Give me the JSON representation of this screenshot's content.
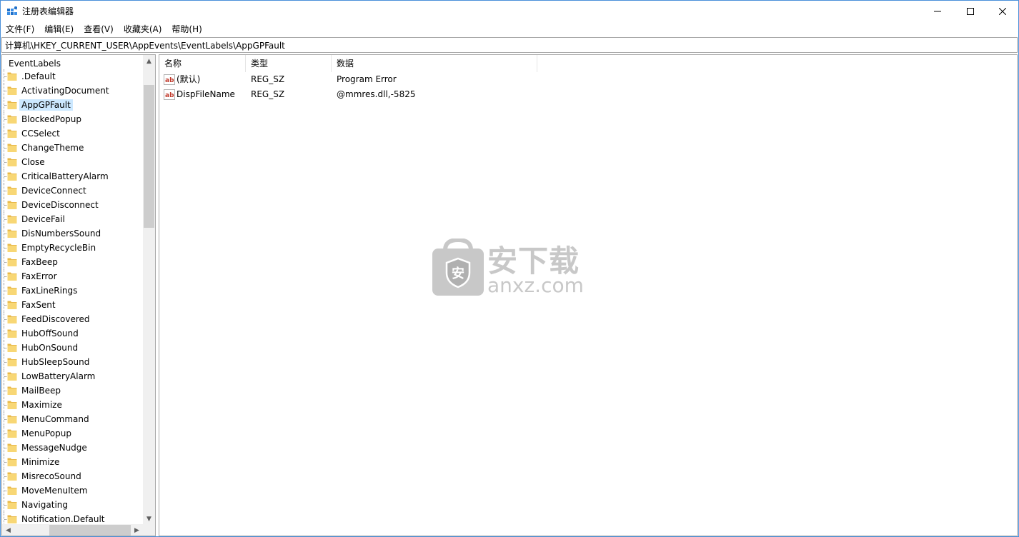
{
  "window": {
    "title": "注册表编辑器"
  },
  "menu": {
    "items": [
      "文件(F)",
      "编辑(E)",
      "查看(V)",
      "收藏夹(A)",
      "帮助(H)"
    ]
  },
  "address": {
    "path": "计算机\\HKEY_CURRENT_USER\\AppEvents\\EventLabels\\AppGPFault"
  },
  "tree": {
    "root": "EventLabels",
    "items": [
      ".Default",
      "ActivatingDocument",
      "AppGPFault",
      "BlockedPopup",
      "CCSelect",
      "ChangeTheme",
      "Close",
      "CriticalBatteryAlarm",
      "DeviceConnect",
      "DeviceDisconnect",
      "DeviceFail",
      "DisNumbersSound",
      "EmptyRecycleBin",
      "FaxBeep",
      "FaxError",
      "FaxLineRings",
      "FaxSent",
      "FeedDiscovered",
      "HubOffSound",
      "HubOnSound",
      "HubSleepSound",
      "LowBatteryAlarm",
      "MailBeep",
      "Maximize",
      "MenuCommand",
      "MenuPopup",
      "MessageNudge",
      "Minimize",
      "MisrecoSound",
      "MoveMenuItem",
      "Navigating",
      "Notification.Default"
    ],
    "selected": "AppGPFault"
  },
  "list": {
    "columns": [
      "名称",
      "类型",
      "数据"
    ],
    "rows": [
      {
        "name": "(默认)",
        "type": "REG_SZ",
        "data": "Program Error"
      },
      {
        "name": "DispFileName",
        "type": "REG_SZ",
        "data": "@mmres.dll,-5825"
      }
    ]
  },
  "watermark": {
    "cn": "安下载",
    "en": "anxz.com",
    "shield_char": "安"
  },
  "icons": {
    "app": "registry-editor-icon",
    "folder": "folder-icon",
    "value": "string-value-icon"
  },
  "colors": {
    "selection": "#cce8ff",
    "folder": "#f8d775",
    "border": "#a9a9a9"
  }
}
